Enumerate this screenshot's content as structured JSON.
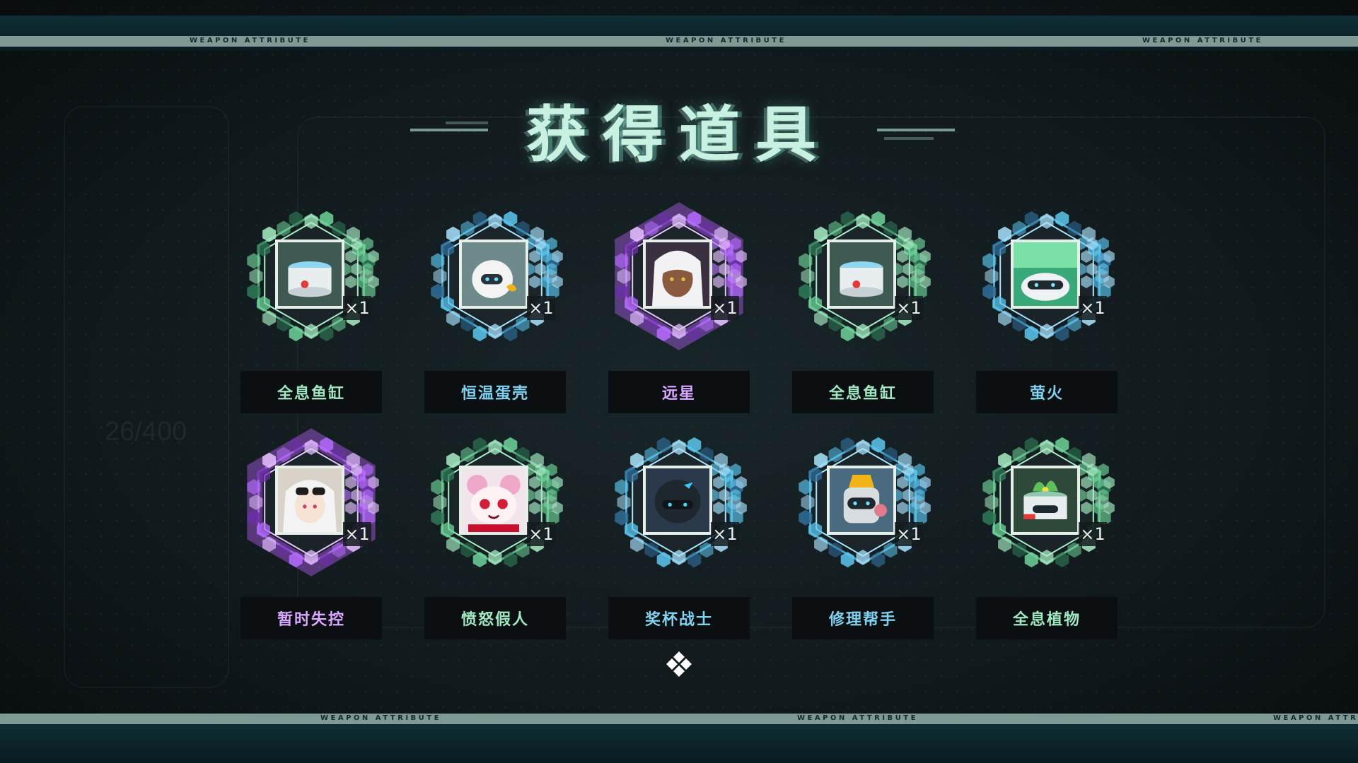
{
  "banner": {
    "text": "WEAPON ATTRIBUTE"
  },
  "title": "获得道具",
  "background_faint": {
    "counter": "26/400"
  },
  "rarity_colors": {
    "green": "#6fd49a",
    "blue": "#5cc7f0",
    "purple": "#b66bff"
  },
  "items": [
    {
      "name": "全息鱼缸",
      "qty": "×1",
      "rarity": "green",
      "icon": "holo-fishtank-icon"
    },
    {
      "name": "恒温蛋壳",
      "qty": "×1",
      "rarity": "blue",
      "icon": "thermo-eggshell-icon"
    },
    {
      "name": "远星",
      "qty": "×1",
      "rarity": "purple",
      "icon": "yuanxing-character-icon"
    },
    {
      "name": "全息鱼缸",
      "qty": "×1",
      "rarity": "green",
      "icon": "holo-fishtank-icon"
    },
    {
      "name": "萤火",
      "qty": "×1",
      "rarity": "blue",
      "icon": "firefly-robot-icon"
    },
    {
      "name": "暂时失控",
      "qty": "×1",
      "rarity": "purple",
      "icon": "temporary-loss-character-icon"
    },
    {
      "name": "愤怒假人",
      "qty": "×1",
      "rarity": "green",
      "icon": "angry-dummy-icon"
    },
    {
      "name": "奖杯战士",
      "qty": "×1",
      "rarity": "blue",
      "icon": "trophy-warrior-icon"
    },
    {
      "name": "修理帮手",
      "qty": "×1",
      "rarity": "blue",
      "icon": "repair-helper-icon"
    },
    {
      "name": "全息植物",
      "qty": "×1",
      "rarity": "green",
      "icon": "holo-plant-icon"
    }
  ]
}
